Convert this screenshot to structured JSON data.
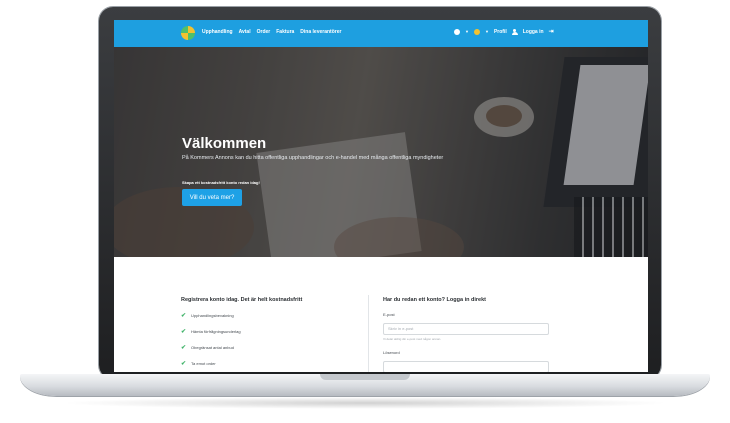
{
  "nav": {
    "links": [
      "Upphandling",
      "Avtal",
      "Order",
      "Faktura",
      "Dina leverantörer"
    ],
    "profile_label": "Profil",
    "login_label": "Logga in"
  },
  "hero": {
    "title": "Välkommen",
    "subtitle": "På Kommers Annons kan du hitta offentliga upphandlingar och e-handel med många offentliga myndigheter",
    "small_text": "Skapa ett kostnadsfritt konto redan idag!",
    "cta_label": "Vill du veta mer?"
  },
  "register": {
    "title": "Registrera konto idag. Det är helt kostnadsfritt",
    "features": [
      "Upphandlingsbevakning",
      "Hämta förfrågningsunderlag",
      "Obegränsat antal anbud",
      "Ta emot order"
    ]
  },
  "login": {
    "title": "Har du redan ett konto? Logga in direkt",
    "email_label": "E-post",
    "email_placeholder": "Skriv in e-post",
    "email_hint": "Vi delar aldrig din e-post med någon annan.",
    "password_label": "Lösenord"
  },
  "colors": {
    "nav_bg": "#1e9fe0",
    "cta_bg": "#1ea1e6",
    "check": "#41b36a"
  }
}
